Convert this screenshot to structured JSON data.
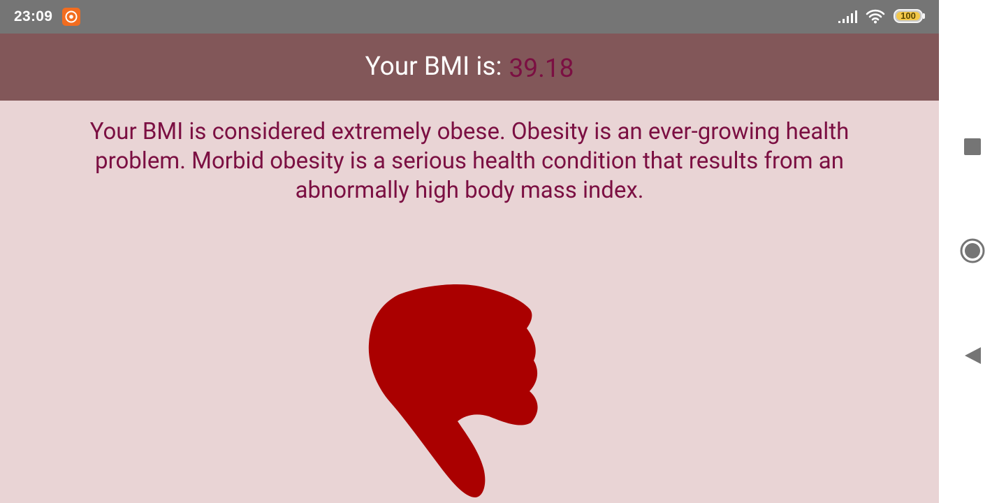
{
  "status_bar": {
    "time": "23:09",
    "battery_level": "100",
    "icons": [
      "screen-recorder-icon",
      "signal-icon",
      "wifi-icon",
      "battery-icon"
    ]
  },
  "header": {
    "label": "Your BMI is:",
    "value": "39.18"
  },
  "result": {
    "message": "Your BMI is considered extremely obese. Obesity is an ever-growing health problem. Morbid obesity is a serious health condition that results from an abnormally high body mass index.",
    "image": "thumbs-down-icon"
  },
  "nav_bar": {
    "buttons": [
      "recents-button",
      "home-button",
      "back-button"
    ]
  },
  "colors": {
    "status_bar": "#757575",
    "header_bg": "#825759",
    "page_bg": "#e9d4d5",
    "accent_text": "#7b0f42",
    "thumb": "#aa0000"
  }
}
